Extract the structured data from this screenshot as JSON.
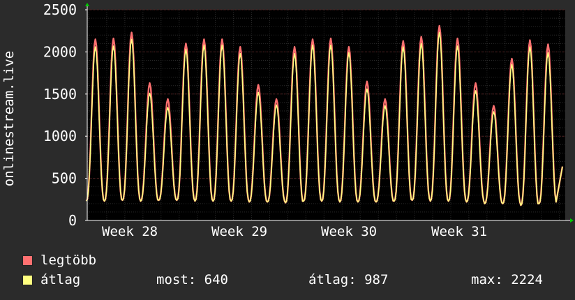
{
  "chart_data": {
    "type": "line",
    "ylabel": "onlinestream.live",
    "ylim": [
      0,
      2500
    ],
    "yticks": [
      0,
      500,
      1000,
      1500,
      2000,
      2500
    ],
    "x_ticks": [
      "Week 28",
      "Week 29",
      "Week 30",
      "Week 31"
    ],
    "grid": true,
    "colors": {
      "background": "#000000",
      "page": "#2b2b2b",
      "grid": "#3a1a1a",
      "axis": "#ffffff"
    },
    "series": [
      {
        "name": "legtöbb",
        "color": "#ff7070",
        "daily_peaks": [
          2150,
          2160,
          2230,
          1630,
          1440,
          2100,
          2150,
          2150,
          2060,
          1610,
          1440,
          2060,
          2150,
          2160,
          2060,
          1650,
          1440,
          2130,
          2180,
          2310,
          2160,
          1630,
          1360,
          1920,
          2140,
          2090
        ],
        "daily_troughs": [
          230,
          230,
          240,
          230,
          240,
          240,
          230,
          230,
          230,
          220,
          220,
          210,
          230,
          230,
          220,
          220,
          220,
          230,
          240,
          230,
          230,
          220,
          200,
          200,
          180,
          200
        ]
      },
      {
        "name": "átlag",
        "color": "#ffff80",
        "daily_peaks": [
          2060,
          2070,
          2150,
          1510,
          1340,
          2030,
          2080,
          2080,
          1980,
          1520,
          1370,
          1980,
          2080,
          2080,
          1990,
          1560,
          1360,
          2060,
          2100,
          2230,
          2070,
          1540,
          1290,
          1850,
          2060,
          1990
        ],
        "daily_troughs": [
          230,
          230,
          240,
          230,
          240,
          240,
          230,
          230,
          230,
          220,
          220,
          210,
          230,
          230,
          220,
          220,
          220,
          230,
          240,
          230,
          230,
          220,
          200,
          200,
          180,
          200
        ]
      }
    ],
    "end_value": 640
  },
  "legend": {
    "max_label": "legtöbb",
    "avg_label": "átlag",
    "max_color": "#ff7070",
    "avg_color": "#ffff80"
  },
  "stats": {
    "current": "most: 640",
    "average": "átlag: 987",
    "maximum": "max: 2224"
  }
}
